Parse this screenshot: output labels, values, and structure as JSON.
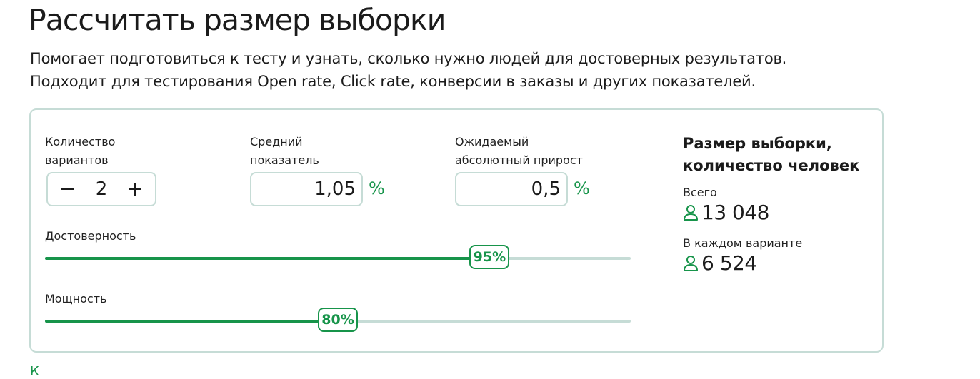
{
  "header": {
    "title": "Рассчитать размер выборки",
    "subtitle_line1": "Помогает подготовиться к тесту и узнать, сколько нужно людей для достоверных результатов.",
    "subtitle_line2": "Подходит для тестирования Open rate, Click rate, конверсии в заказы и других показателей."
  },
  "calculator": {
    "variants": {
      "label_line1": "Количество",
      "label_line2": "вариантов",
      "value": "2"
    },
    "baseline": {
      "label_line1": "Средний",
      "label_line2": "показатель",
      "value": "1,05",
      "unit": "%"
    },
    "uplift": {
      "label_line1": "Ожидаемый",
      "label_line2": "абсолютный прирост",
      "value": "0,5",
      "unit": "%"
    },
    "confidence": {
      "label": "Достоверность",
      "value_label": "95%",
      "fill_fraction": 0.759
    },
    "power": {
      "label": "Мощность",
      "value_label": "80%",
      "fill_fraction": 0.5
    }
  },
  "result": {
    "title_line1": "Размер выборки,",
    "title_line2": "количество человек",
    "total_label": "Всего",
    "total_value": "13 048",
    "per_variant_label": "В каждом варианте",
    "per_variant_value": "6 524",
    "icon": "person-icon"
  },
  "colors": {
    "accent": "#17944a",
    "border": "#c6dcd6",
    "text": "#1b1b1b"
  },
  "footer": {
    "cut_link_text": "К"
  }
}
